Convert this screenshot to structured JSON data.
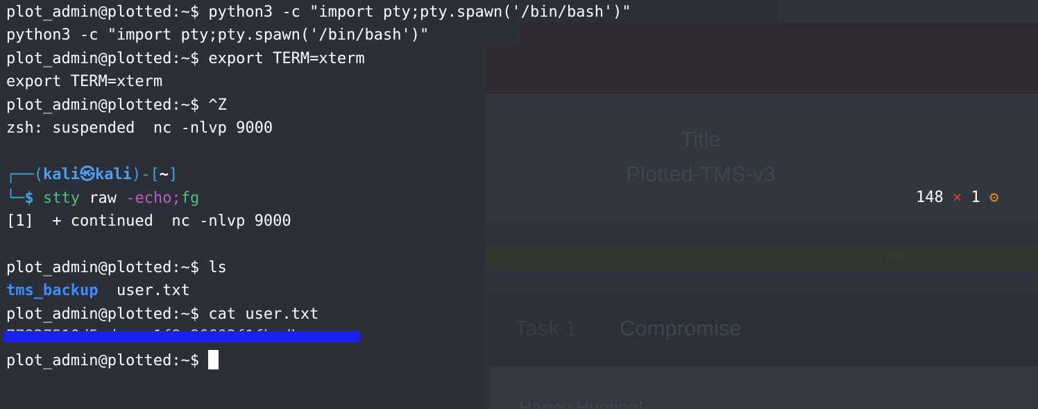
{
  "terminal": {
    "lines": [
      "plot_admin@plotted:~$ python3 -c \"import pty;pty.spawn('/bin/bash')\"",
      "python3 -c \"import pty;pty.spawn('/bin/bash')\"",
      "plot_admin@plotted:~$ export TERM=xterm",
      "export TERM=xterm",
      "plot_admin@plotted:~$ ^Z",
      "zsh: suspended  nc -nlvp 9000"
    ],
    "kali_prompt": {
      "open": "┌──(",
      "user": "kali㉿kali",
      "mid": ")-[",
      "cwd": "~",
      "close": "]",
      "corner": "└─",
      "dollar": "$",
      "cmd": "stty",
      "arg1": "raw",
      "flag": "-echo",
      "semi": ";",
      "fg": "fg"
    },
    "continued": "[1]  + continued  nc -nlvp 9000",
    "ls_prompt": "plot_admin@plotted:~$ ls",
    "ls_dir": "tms_backup",
    "ls_file": "  user.txt",
    "cat_prompt": "plot_admin@plotted:~$ cat user.txt",
    "redacted_hash": "77927510d5edacea1f9e86602f1fbadb",
    "final_prompt": "plot_admin@plotted:~$ ",
    "status": {
      "cols": "148",
      "x": "×",
      "rows": "1",
      "gear": "⚙"
    }
  },
  "background_page": {
    "title_label": "Title",
    "title_value": "Plotted-TMS-v3",
    "progress_label": "80%",
    "task_number": "Task 1",
    "task_name": "Compromise",
    "task_body": "Happy Hunting!"
  },
  "colors": {
    "terminal_bg": "#2b2f37",
    "prompt_blue": "#3da3e0",
    "command_green": "#4ec07a",
    "flag_purple": "#b55fc2",
    "redaction_blue": "#1a21ef"
  }
}
